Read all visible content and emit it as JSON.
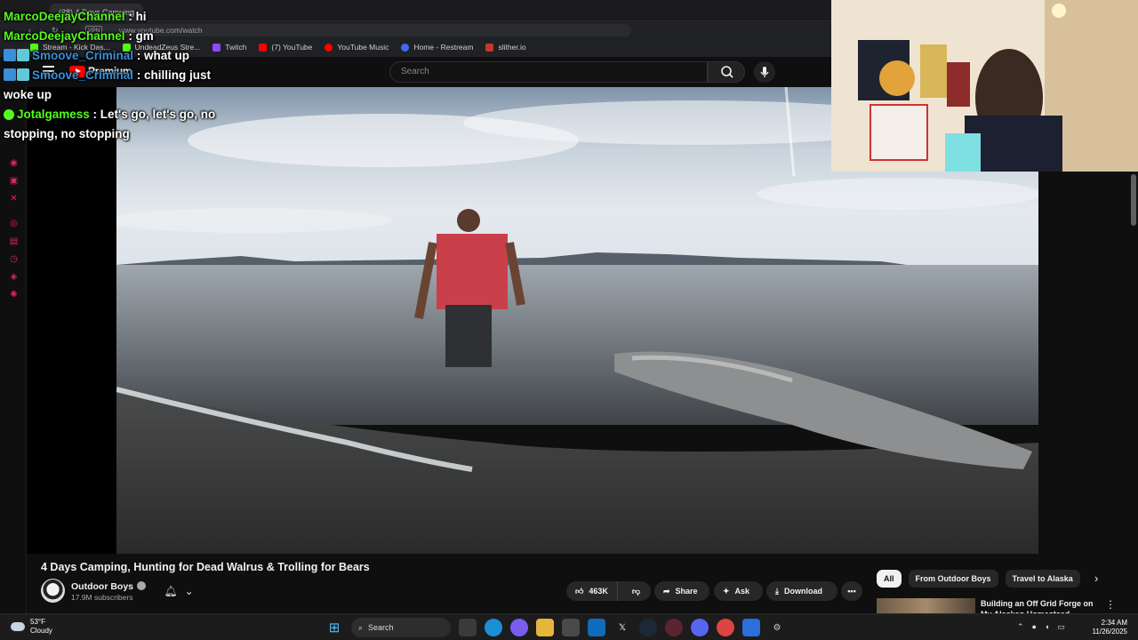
{
  "browser": {
    "tab_title": "(38) 4 Days Camping",
    "url": "www.youtube.com/watch",
    "vpn_label": "VPN",
    "bookmarks": [
      {
        "label": "Stream - Kick Das...",
        "color": "#53fc18"
      },
      {
        "label": "UndeadZeus Stre...",
        "color": "#53fc18"
      },
      {
        "label": "Twitch",
        "color": "#9146ff"
      },
      {
        "label": "(7) YouTube",
        "color": "#ff0000"
      },
      {
        "label": "YouTube Music",
        "color": "#ff0000"
      },
      {
        "label": "Home - Restream",
        "color": "#3b6cf5"
      },
      {
        "label": "slither.io",
        "color": "#c0392b"
      }
    ]
  },
  "youtube": {
    "logo_text": "Premium",
    "search_placeholder": "Search",
    "video_title": "4 Days Camping, Hunting for Dead Walrus & Trolling for Bears",
    "channel_name": "Outdoor Boys",
    "subscribers": "17.9M subscribers",
    "likes": "463K",
    "share_label": "Share",
    "ask_label": "Ask",
    "download_label": "Download",
    "chips": [
      "All",
      "From Outdoor Boys",
      "Travel to Alaska"
    ],
    "recommendation_title": "Building an Off Grid Forge on My Alaskan Homestead"
  },
  "chat": [
    {
      "user": "MarcoDeejayChannel",
      "message": "hi",
      "user_color": "#53fc18",
      "badges": []
    },
    {
      "user": "MarcoDeejayChannel",
      "message": "gm",
      "user_color": "#53fc18",
      "badges": []
    },
    {
      "user": "Smoove_Criminal",
      "message": "what up",
      "user_color": "#3a8fd6",
      "badges": [
        "kick",
        "grid"
      ]
    },
    {
      "user": "Smoove_Criminal",
      "message": "chilling just woke up",
      "user_color": "#3a8fd6",
      "badges": [
        "kick",
        "grid"
      ]
    },
    {
      "user": "Jotalgamess",
      "message": "Let's go, let's go, no stopping, no stopping",
      "user_color": "#53fc18",
      "badges": [
        "check"
      ]
    }
  ],
  "taskbar": {
    "temperature": "53°F",
    "condition": "Cloudy",
    "search_label": "Search",
    "time": "2:34 AM",
    "date": "11/26/2025"
  }
}
